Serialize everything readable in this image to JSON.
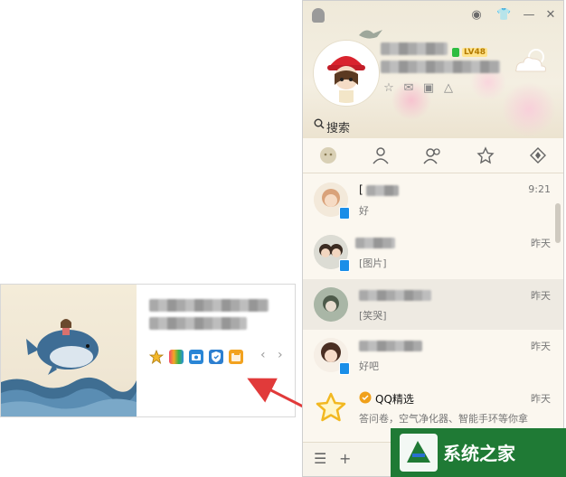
{
  "profile": {
    "level": "LV48",
    "search_placeholder": "搜索"
  },
  "conversations": [
    {
      "name": "[",
      "message": "好",
      "time": "9:21"
    },
    {
      "name": "",
      "message": "[图片]",
      "time": "昨天"
    },
    {
      "name": "",
      "message": "[笑哭]",
      "time": "昨天"
    },
    {
      "name": "",
      "message": "好吧",
      "time": "昨天"
    },
    {
      "name": "QQ精选",
      "message": "答问卷，空气净化器、智能手环等你拿",
      "time": "昨天"
    }
  ],
  "watermark": {
    "text": "系统之家"
  },
  "colors": {
    "accent": "#1a8ee8",
    "arrow": "#e13a3a",
    "online": "#2ebd41"
  }
}
